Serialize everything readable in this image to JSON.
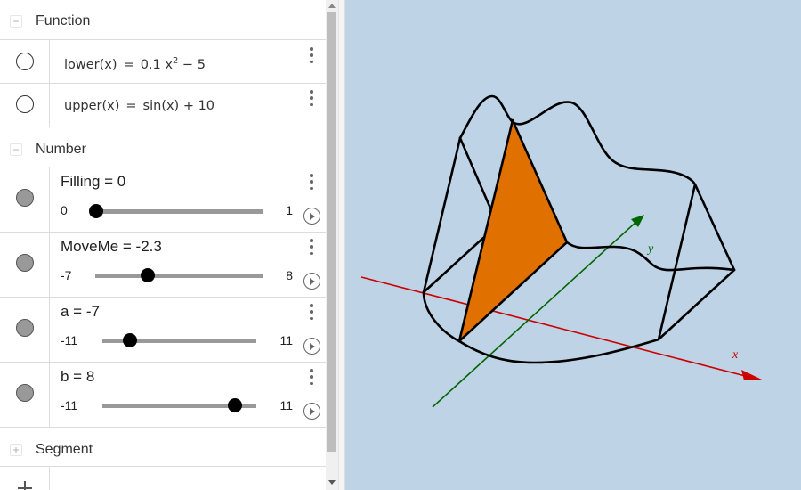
{
  "algebra": {
    "groups": [
      {
        "label": "Function",
        "toggle": "minus",
        "expanded": true
      },
      {
        "label": "Number",
        "toggle": "minus",
        "expanded": true
      },
      {
        "label": "Segment",
        "toggle": "plus",
        "expanded": false
      }
    ],
    "functions": [
      {
        "name": "lower(x)",
        "eq": "=",
        "rhs_pre": "0.1 x",
        "rhs_sup": "2",
        "rhs_post": " − 5",
        "visible": false
      },
      {
        "name": "upper(x)",
        "eq": "=",
        "rhs_pre": "sin(x) + 10",
        "rhs_sup": "",
        "rhs_post": "",
        "visible": false
      }
    ],
    "sliders": [
      {
        "title": "Filling = 0",
        "name": "Filling",
        "value": 0,
        "min": "0",
        "max": "1",
        "min_num": 0,
        "max_num": 1,
        "visible": true
      },
      {
        "title": "MoveMe = -2.3",
        "name": "MoveMe",
        "value": -2.3,
        "min": "-7",
        "max": "8",
        "min_num": -7,
        "max_num": 8,
        "visible": true
      },
      {
        "title": "a = -7",
        "name": "a",
        "value": -7,
        "min": "-11",
        "max": "11",
        "min_num": -11,
        "max_num": 11,
        "visible": true
      },
      {
        "title": "b = 8",
        "name": "b",
        "value": 8,
        "min": "-11",
        "max": "11",
        "min_num": -11,
        "max_num": 11,
        "visible": true
      }
    ],
    "input_bar": {
      "icon": "plus-icon"
    }
  },
  "graphics": {
    "background": "#bed3e6",
    "axes": {
      "x_label": "x",
      "y_label": "y",
      "x_color": "#cc0000",
      "y_color": "#006600"
    },
    "solid": {
      "edge_color": "#000000",
      "triangle_fill": "#e07000"
    }
  }
}
